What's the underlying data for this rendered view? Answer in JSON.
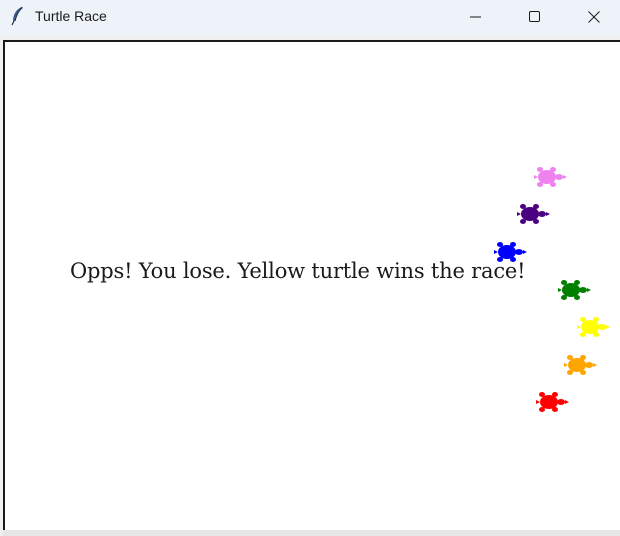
{
  "window": {
    "title": "Turtle Race",
    "controls": {
      "minimize": "minimize-icon",
      "maximize": "maximize-icon",
      "close": "close-icon"
    }
  },
  "canvas": {
    "background": "#ffffff",
    "message": "Opps! You lose. Yellow turtle wins the race!"
  },
  "turtles": [
    {
      "color_name": "violet",
      "color": "#ee82ee"
    },
    {
      "color_name": "indigo",
      "color": "#4b0082"
    },
    {
      "color_name": "blue",
      "color": "#0000ff"
    },
    {
      "color_name": "green",
      "color": "#008000"
    },
    {
      "color_name": "yellow",
      "color": "#ffff00"
    },
    {
      "color_name": "orange",
      "color": "#ffa500"
    },
    {
      "color_name": "red",
      "color": "#ff0000"
    }
  ]
}
